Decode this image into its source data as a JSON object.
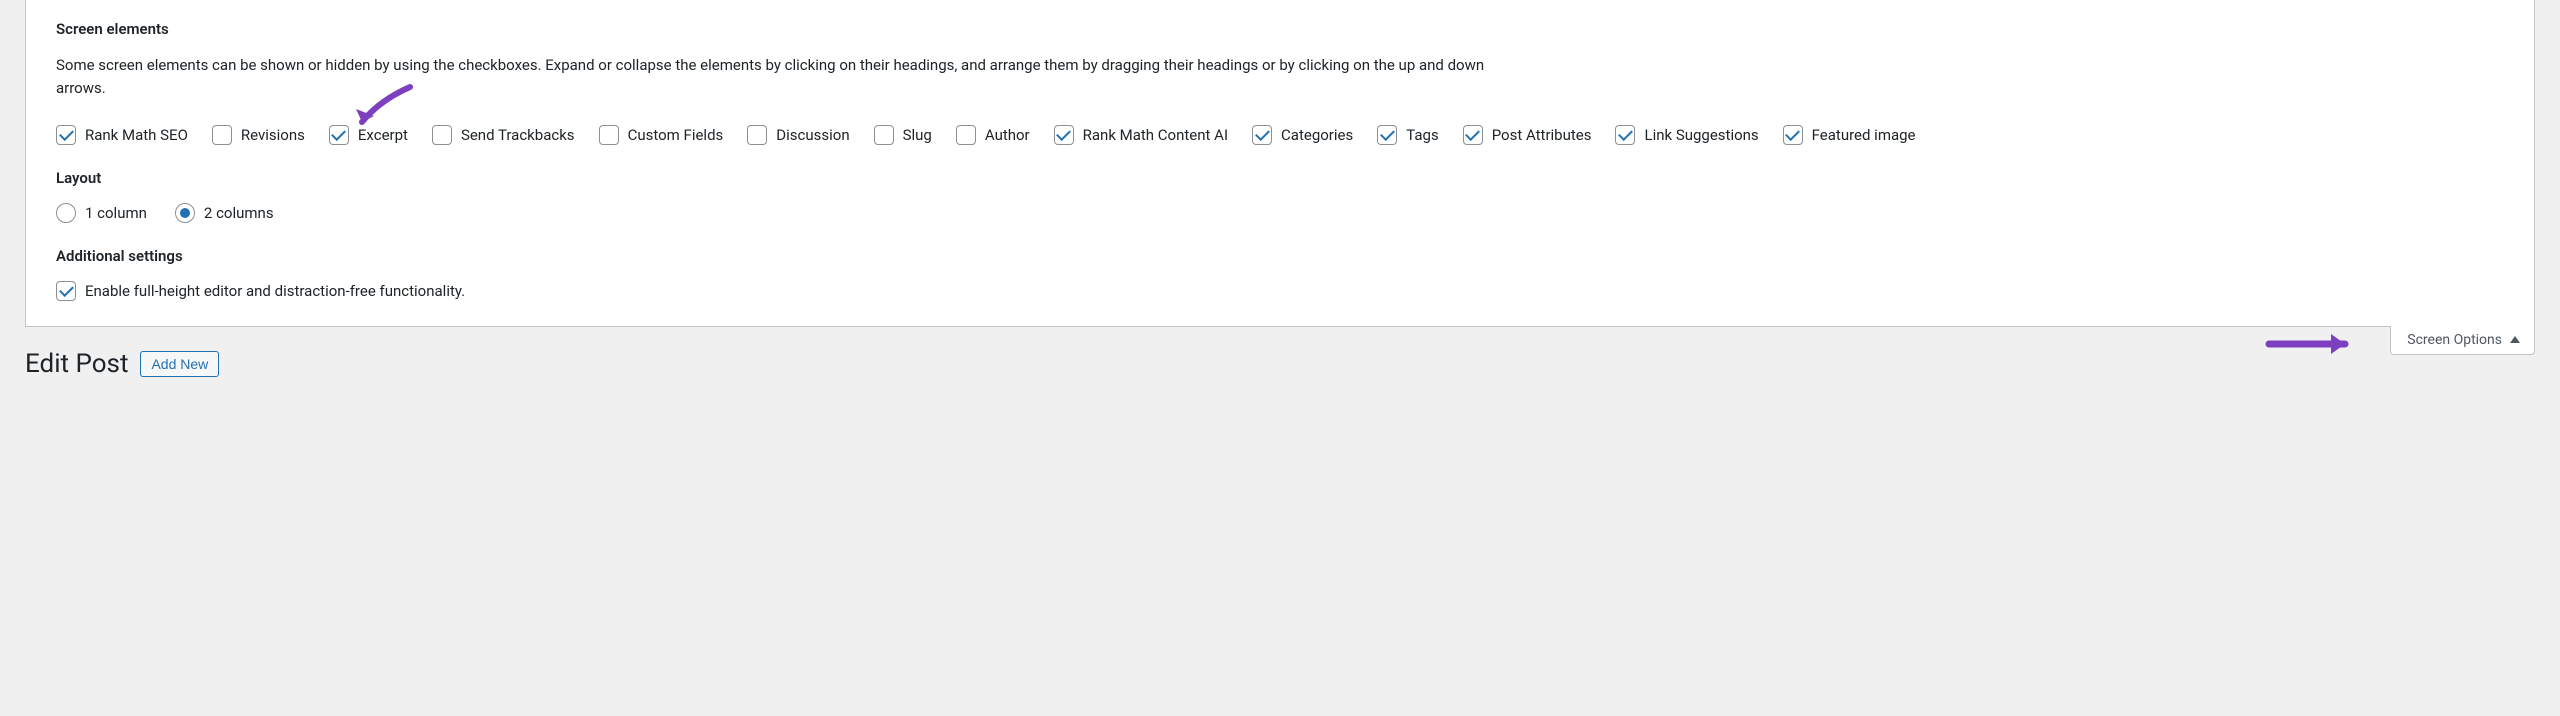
{
  "sections": {
    "screen_elements": {
      "heading": "Screen elements",
      "description": "Some screen elements can be shown or hidden by using the checkboxes. Expand or collapse the elements by clicking on their headings, and arrange them by dragging their headings or by clicking on the up and down arrows.",
      "items": [
        {
          "id": "rank-math-seo",
          "label": "Rank Math SEO",
          "checked": true
        },
        {
          "id": "revisions",
          "label": "Revisions",
          "checked": false
        },
        {
          "id": "excerpt",
          "label": "Excerpt",
          "checked": true
        },
        {
          "id": "send-trackbacks",
          "label": "Send Trackbacks",
          "checked": false
        },
        {
          "id": "custom-fields",
          "label": "Custom Fields",
          "checked": false
        },
        {
          "id": "discussion",
          "label": "Discussion",
          "checked": false
        },
        {
          "id": "slug",
          "label": "Slug",
          "checked": false
        },
        {
          "id": "author",
          "label": "Author",
          "checked": false
        },
        {
          "id": "rank-math-content-ai",
          "label": "Rank Math Content AI",
          "checked": true
        },
        {
          "id": "categories",
          "label": "Categories",
          "checked": true
        },
        {
          "id": "tags",
          "label": "Tags",
          "checked": true
        },
        {
          "id": "post-attributes",
          "label": "Post Attributes",
          "checked": true
        },
        {
          "id": "link-suggestions",
          "label": "Link Suggestions",
          "checked": true
        },
        {
          "id": "featured-image",
          "label": "Featured image",
          "checked": true
        }
      ]
    },
    "layout": {
      "heading": "Layout",
      "options": [
        {
          "id": "col1",
          "label": "1 column",
          "selected": false
        },
        {
          "id": "col2",
          "label": "2 columns",
          "selected": true
        }
      ]
    },
    "additional": {
      "heading": "Additional settings",
      "items": [
        {
          "id": "full-height-editor",
          "label": "Enable full-height editor and distraction-free functionality.",
          "checked": true
        }
      ]
    }
  },
  "screen_options_tab": "Screen Options",
  "page": {
    "title": "Edit Post",
    "add_new": "Add New"
  },
  "colors": {
    "accent": "#2271b1",
    "arrow": "#7b3fbf"
  }
}
